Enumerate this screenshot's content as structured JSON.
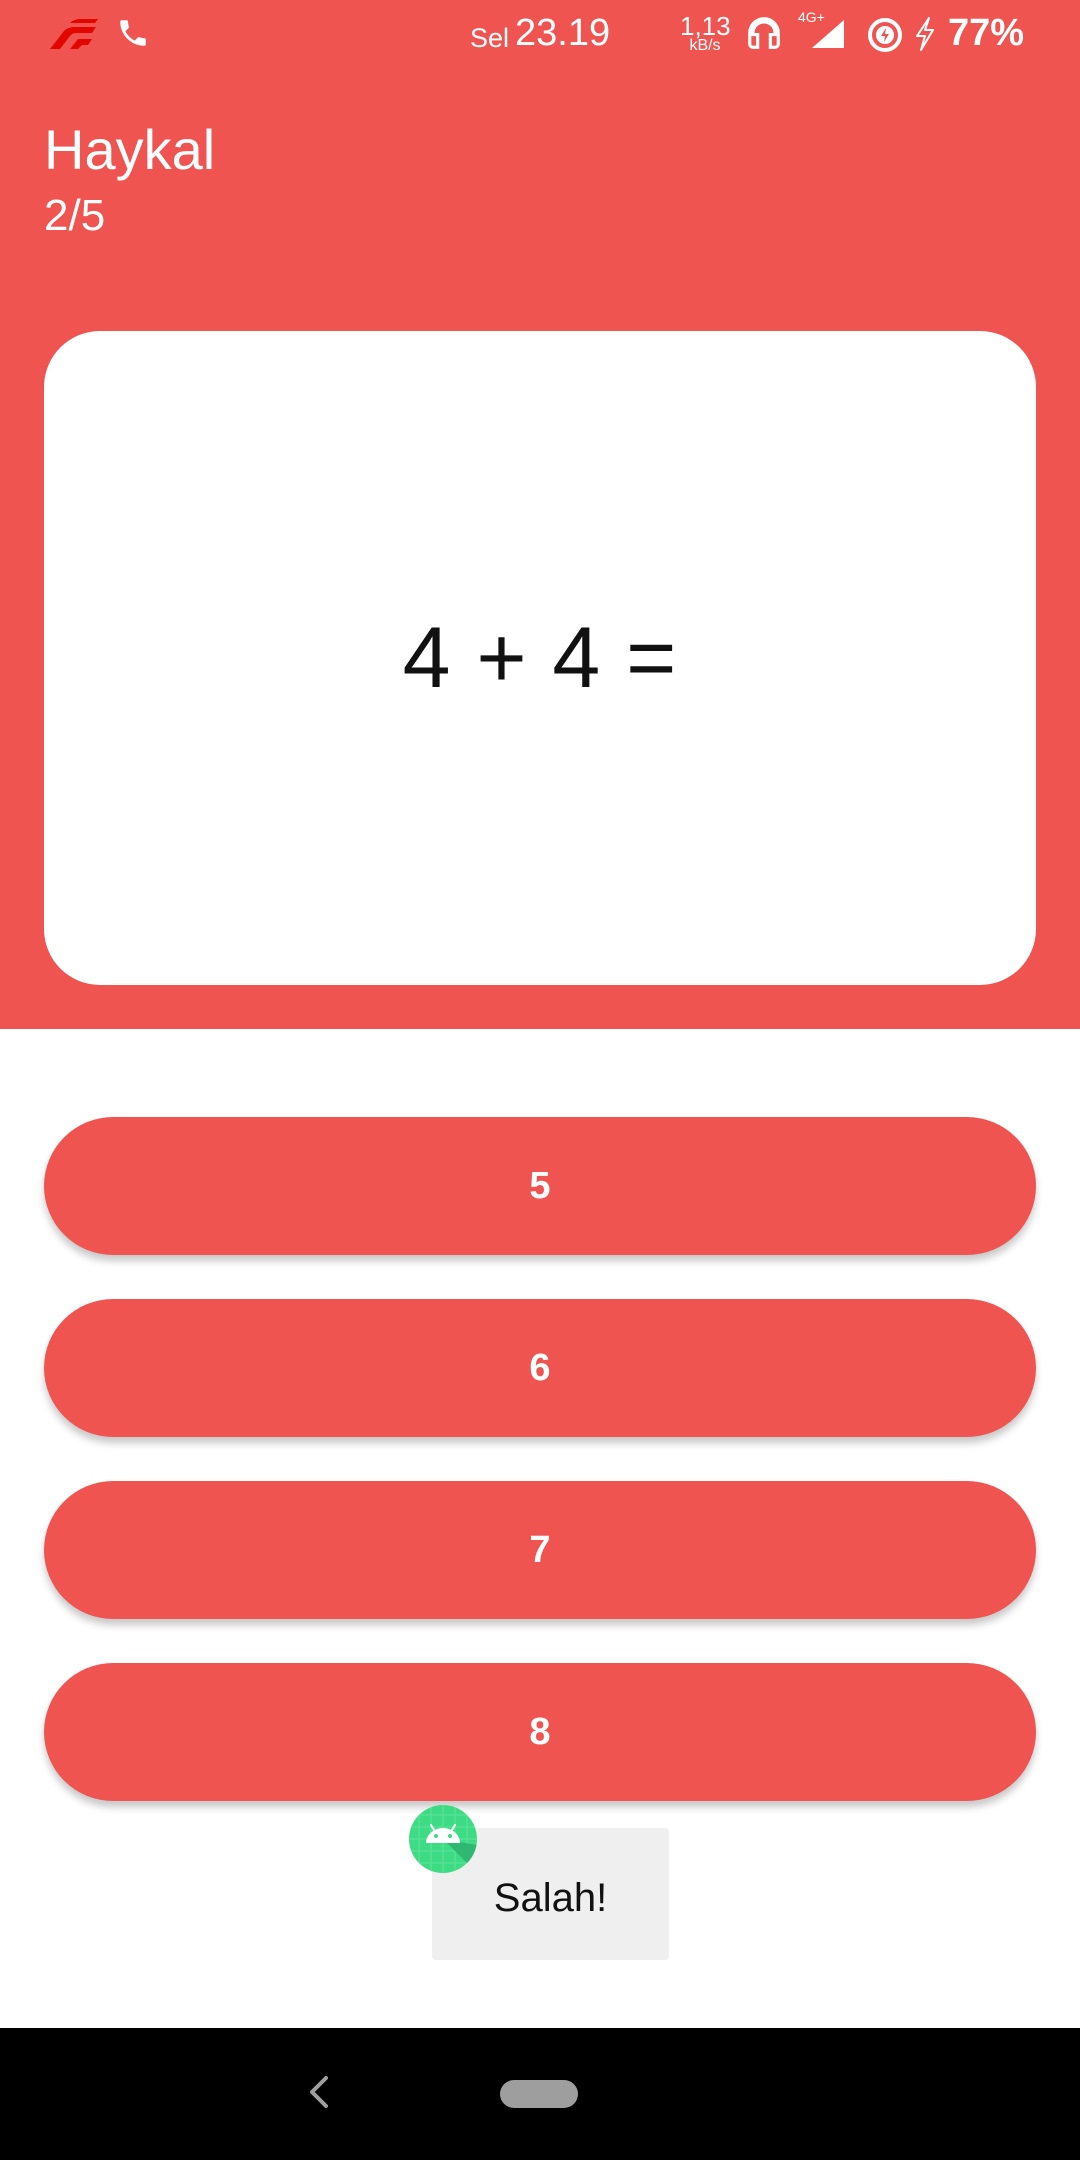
{
  "status_bar": {
    "day": "Sel",
    "time": "23.19",
    "net_speed_value": "1,13",
    "net_speed_unit": "kB/s",
    "network_type": "4G+",
    "battery": "77%",
    "icons": [
      "f1-logo-icon",
      "phone-icon",
      "headset-icon",
      "signal-icon",
      "battery-saver-icon",
      "charging-bolt-icon"
    ]
  },
  "header": {
    "player_name": "Haykal",
    "progress": "2/5"
  },
  "question": {
    "text": "4 + 4 ="
  },
  "answers": [
    "5",
    "6",
    "7",
    "8"
  ],
  "toast": {
    "message": "Salah!",
    "icon": "android-robot-icon"
  },
  "nav": {
    "icons": [
      "back-chevron-icon",
      "home-pill-icon"
    ]
  },
  "colors": {
    "primary": "#EF5451",
    "card": "#FFFFFF",
    "toast_bg": "#EFEFEF",
    "android_green": "#3DDC84"
  }
}
